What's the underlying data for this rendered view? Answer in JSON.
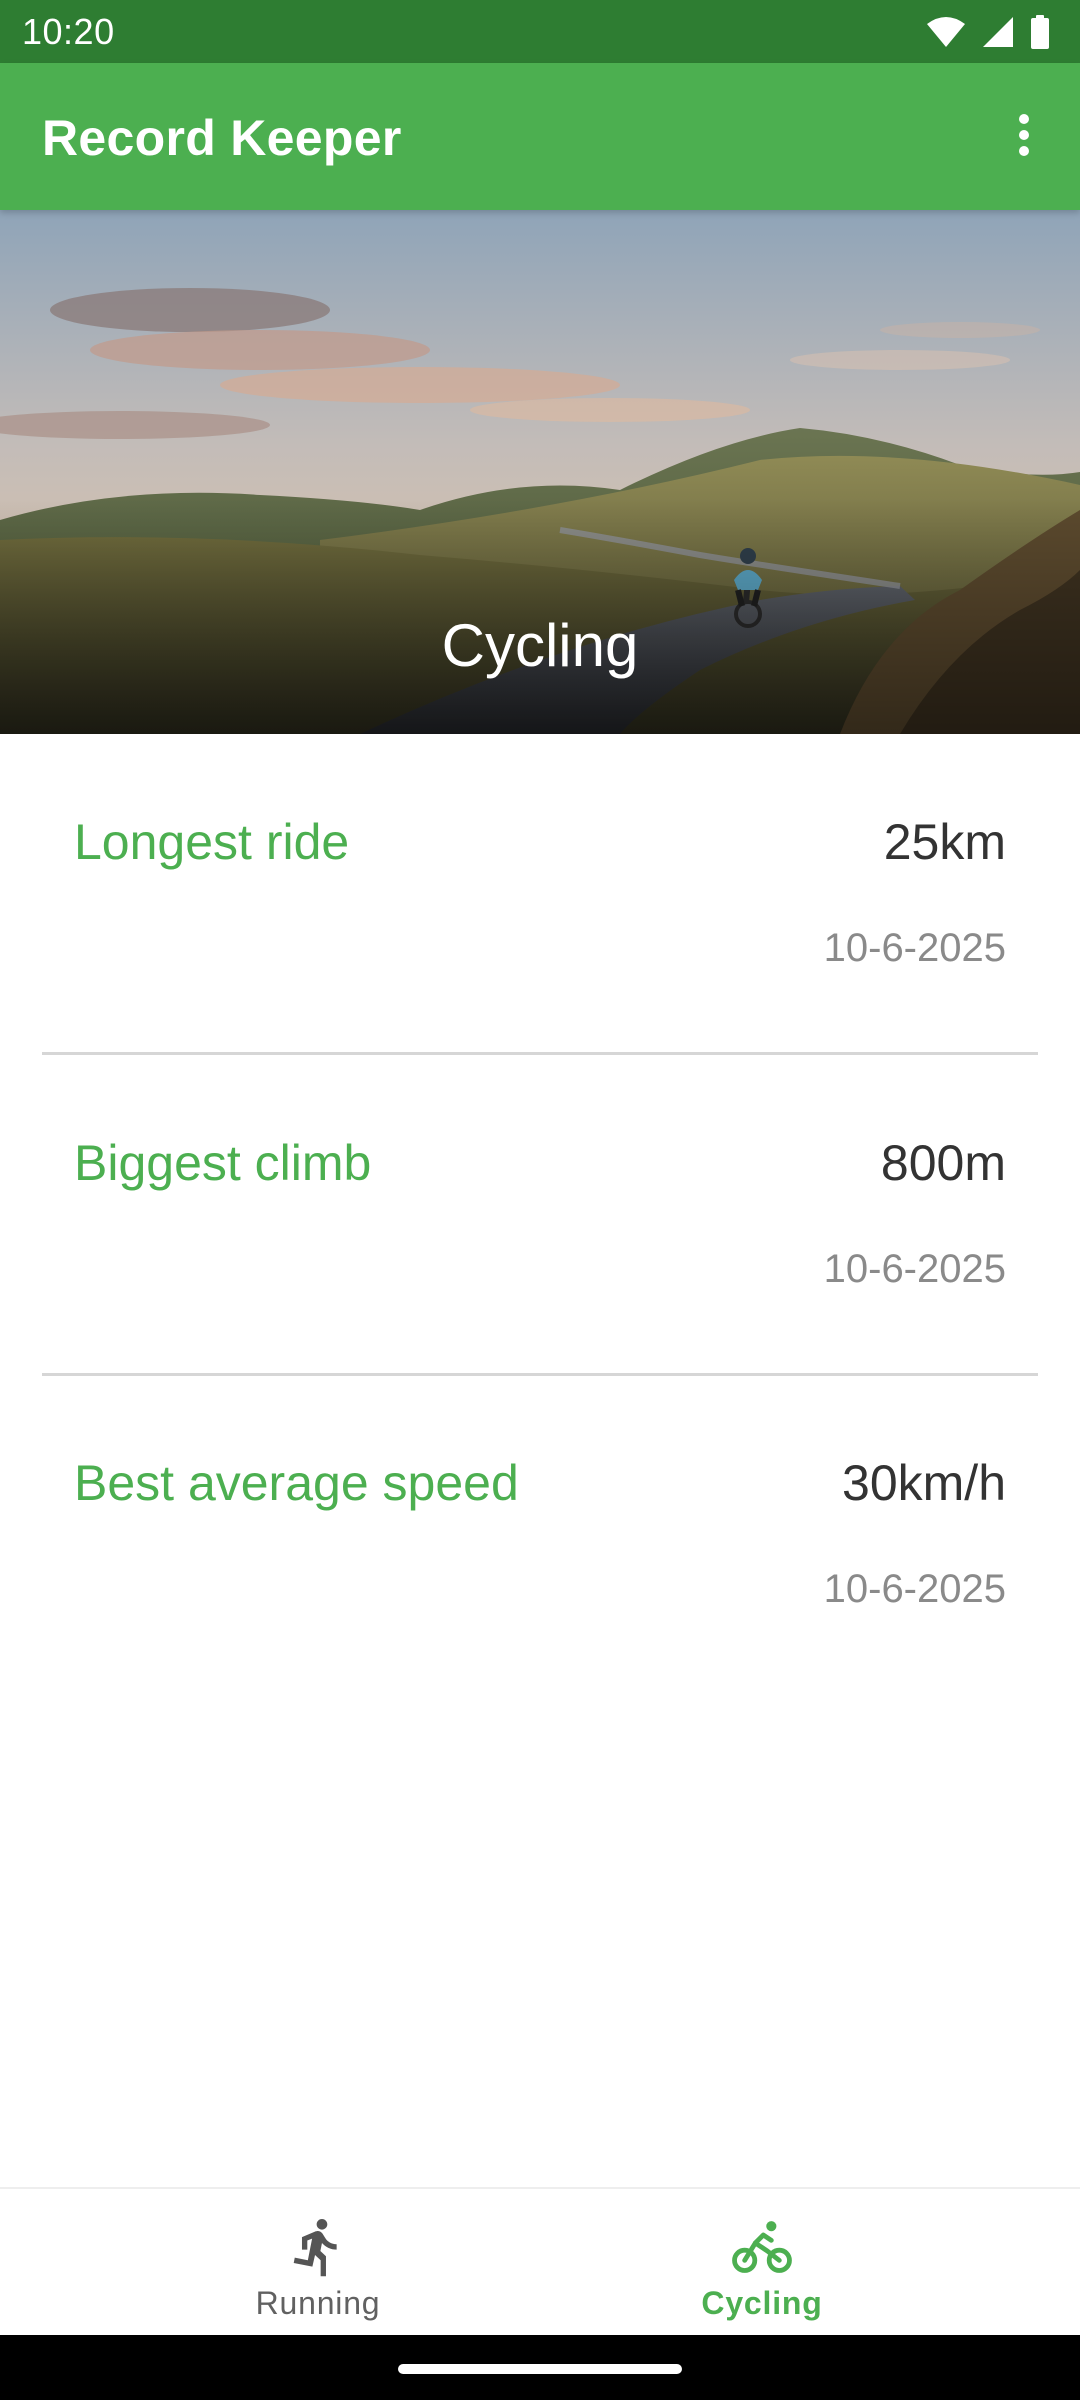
{
  "status_bar": {
    "time": "10:20",
    "icons": [
      "wifi-icon",
      "cellular-signal-icon",
      "battery-icon"
    ]
  },
  "app_bar": {
    "title": "Record Keeper",
    "overflow_icon": "more-vert-icon"
  },
  "hero": {
    "title": "Cycling"
  },
  "records": [
    {
      "label": "Longest ride",
      "value": "25km",
      "date": "10-6-2025"
    },
    {
      "label": "Biggest climb",
      "value": "800m",
      "date": "10-6-2025"
    },
    {
      "label": "Best average speed",
      "value": "30km/h",
      "date": "10-6-2025"
    }
  ],
  "bottom_nav": {
    "items": [
      {
        "label": "Running",
        "icon": "running-icon",
        "selected": false
      },
      {
        "label": "Cycling",
        "icon": "cycling-icon",
        "selected": true
      }
    ]
  },
  "colors": {
    "primary": "#4caf50",
    "primary_dark": "#2e7d32",
    "value_text": "#333333",
    "date_text": "#8a8a8a"
  }
}
